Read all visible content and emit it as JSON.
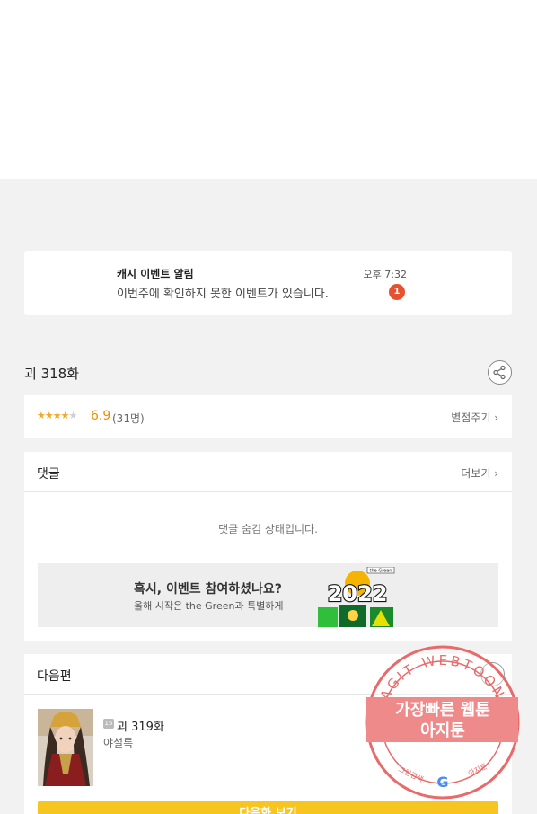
{
  "notification": {
    "title": "캐시 이벤트 알림",
    "body": "이번주에 확인하지 못한 이벤트가 있습니다.",
    "time": "오후 7:32",
    "badge": "1"
  },
  "episode": {
    "title": "괴 318화",
    "rating": 3.5,
    "score": "6.9",
    "count": "(31명)",
    "rate_link": "별점주기 ›"
  },
  "comments": {
    "title": "댓글",
    "more": "더보기 ›",
    "hidden_message": "댓글 숨김 상태입니다."
  },
  "event_banner": {
    "title": "혹시, 이벤트 참여하셨나요?",
    "subtitle": "올해 시작은 the Green과 특별하게",
    "image_year": "2022",
    "image_tag": "the Green"
  },
  "next_episode": {
    "section_title": "다음편",
    "age_badge": "15",
    "title": "괴 319화",
    "author": "야설록",
    "button_label": "다음화 보기"
  },
  "watermark": {
    "top_text": "AGIT WEBTOON",
    "line1": "가장빠른 웹툰",
    "line2": "아지툰",
    "bottom_left": "그림검색",
    "bottom_right": "아지툰",
    "google": "G"
  },
  "colors": {
    "accent_orange": "#f08c00",
    "badge_red": "#e8512f",
    "button_yellow": "#f7c520",
    "watermark_red": "#e86a6a"
  }
}
